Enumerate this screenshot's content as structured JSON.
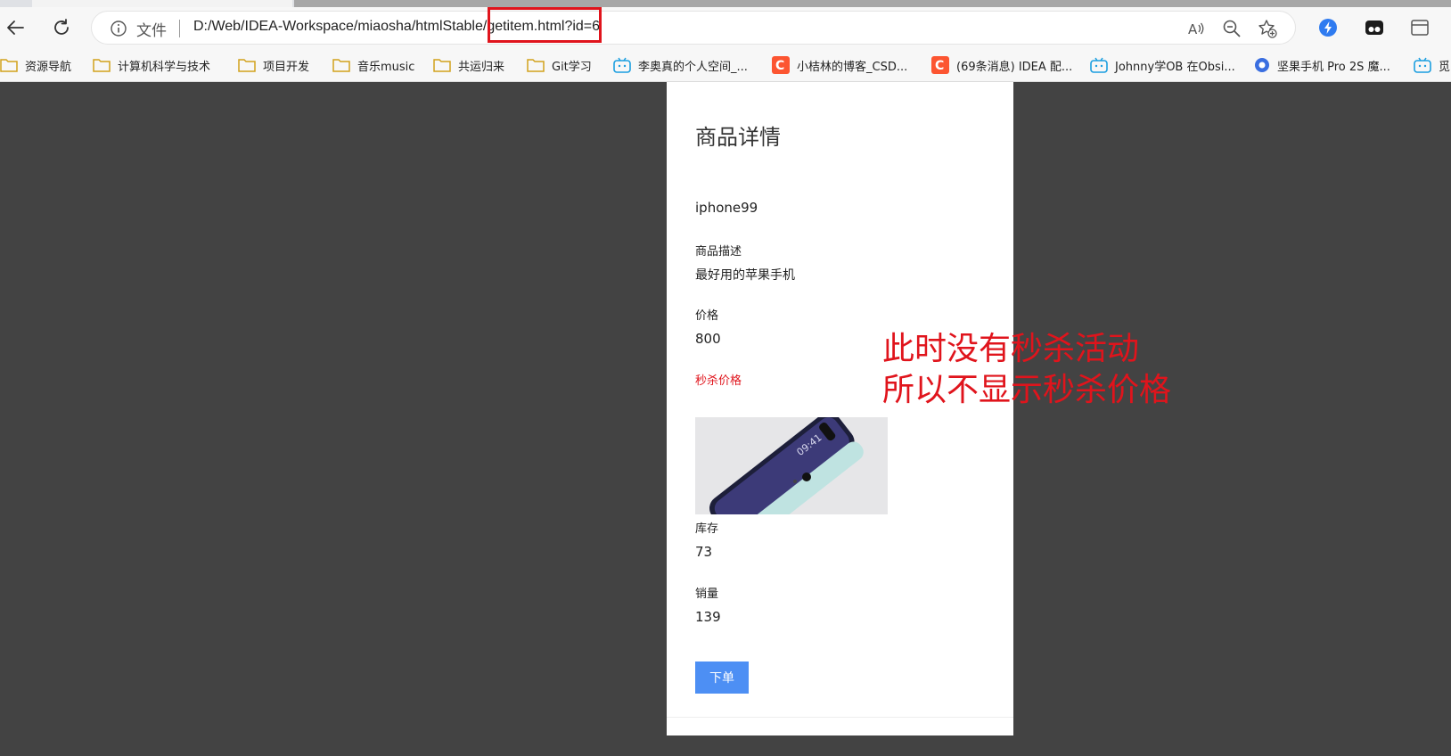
{
  "browser": {
    "scheme_label": "文件",
    "url": "D:/Web/IDEA-Workspace/miaosha/htmlStable/getitem.html?id=6"
  },
  "bookmarks": [
    {
      "label": "资源导航",
      "icon": "folder-icon"
    },
    {
      "label": "计算机科学与技术",
      "icon": "folder-icon"
    },
    {
      "label": "项目开发",
      "icon": "folder-icon"
    },
    {
      "label": "音乐music",
      "icon": "folder-icon"
    },
    {
      "label": "共运归来",
      "icon": "folder-icon"
    },
    {
      "label": "Git学习",
      "icon": "folder-icon"
    },
    {
      "label": "李奥真的个人空间_...",
      "icon": "bilibili-icon"
    },
    {
      "label": "小桔林的博客_CSD...",
      "icon": "csdn-icon"
    },
    {
      "label": "(69条消息) IDEA 配...",
      "icon": "csdn-icon"
    },
    {
      "label": "Johnny学OB 在Obsi...",
      "icon": "bilibili-icon"
    },
    {
      "label": "坚果手机 Pro 2S 魔...",
      "icon": "site-icon"
    },
    {
      "label": "觅",
      "icon": "bilibili-icon"
    }
  ],
  "page": {
    "title": "商品详情",
    "item_name": "iphone99",
    "desc_label": "商品描述",
    "desc_value": "最好用的苹果手机",
    "price_label": "价格",
    "price_value": "800",
    "seckill_label": "秒杀价格",
    "image_alt": "09:41",
    "stock_label": "库存",
    "stock_value": "73",
    "sales_label": "销量",
    "sales_value": "139",
    "order_button": "下单"
  },
  "annotation": {
    "line1": "此时没有秒杀活动",
    "line2": "所以不显示秒杀价格"
  },
  "colors": {
    "accent_red": "#e0141c",
    "button_blue": "#4d8ff4",
    "page_bg": "#434343"
  }
}
